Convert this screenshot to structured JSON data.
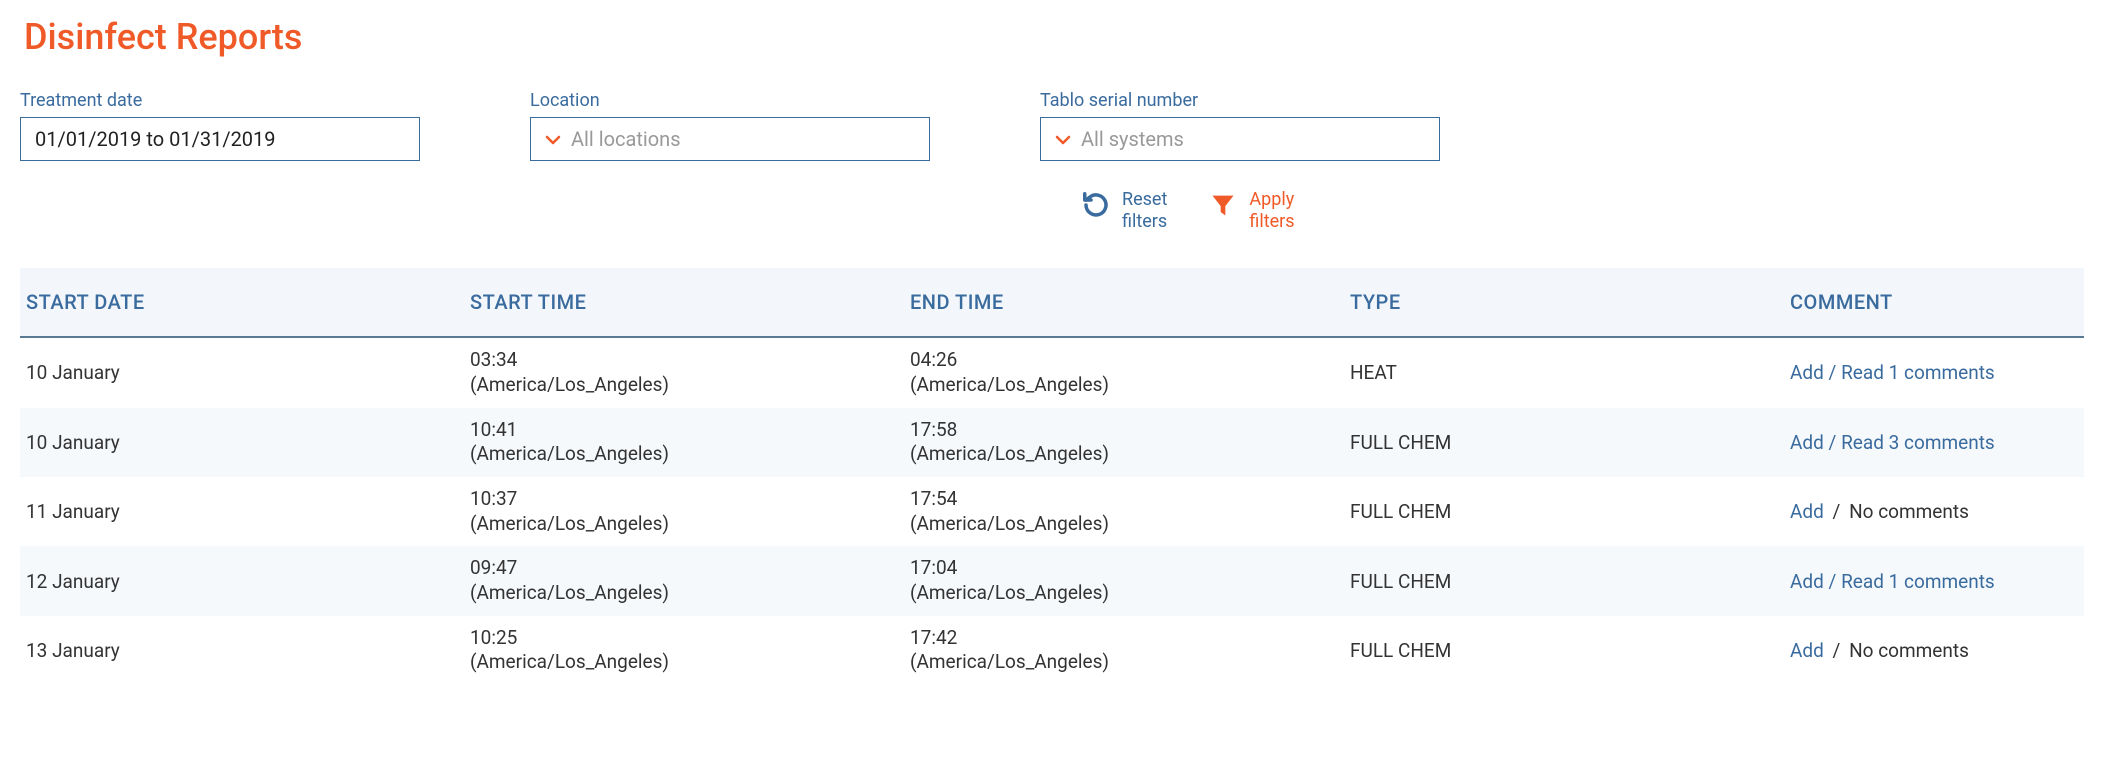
{
  "page": {
    "title": "Disinfect Reports"
  },
  "filters": {
    "treatment_date": {
      "label": "Treatment date",
      "value": "01/01/2019 to 01/31/2019"
    },
    "location": {
      "label": "Location",
      "placeholder": "All locations"
    },
    "serial": {
      "label": "Tablo serial number",
      "placeholder": "All systems"
    }
  },
  "actions": {
    "reset": {
      "line1": "Reset",
      "line2": "filters"
    },
    "apply": {
      "line1": "Apply",
      "line2": "filters"
    }
  },
  "table": {
    "headers": {
      "start_date": "START DATE",
      "start_time": "START TIME",
      "end_time": "END TIME",
      "type": "TYPE",
      "comment": "COMMENT"
    },
    "rows": [
      {
        "start_date": "10 January",
        "start_time": "03:34",
        "start_tz": "(America/Los_Angeles)",
        "end_time": "04:26",
        "end_tz": "(America/Los_Angeles)",
        "type": "HEAT",
        "comment_add": "Add",
        "comment_sep": "/",
        "comment_read": "Read 1 comments",
        "has_read": true
      },
      {
        "start_date": "10 January",
        "start_time": "10:41",
        "start_tz": "(America/Los_Angeles)",
        "end_time": "17:58",
        "end_tz": "(America/Los_Angeles)",
        "type": "FULL CHEM",
        "comment_add": "Add",
        "comment_sep": "/",
        "comment_read": "Read 3 comments",
        "has_read": true
      },
      {
        "start_date": "11 January",
        "start_time": "10:37",
        "start_tz": "(America/Los_Angeles)",
        "end_time": "17:54",
        "end_tz": "(America/Los_Angeles)",
        "type": "FULL CHEM",
        "comment_add": "Add",
        "comment_sep": "/",
        "comment_read": "No comments",
        "has_read": false
      },
      {
        "start_date": "12 January",
        "start_time": "09:47",
        "start_tz": "(America/Los_Angeles)",
        "end_time": "17:04",
        "end_tz": "(America/Los_Angeles)",
        "type": "FULL CHEM",
        "comment_add": "Add",
        "comment_sep": "/",
        "comment_read": "Read 1 comments",
        "has_read": true
      },
      {
        "start_date": "13 January",
        "start_time": "10:25",
        "start_tz": "(America/Los_Angeles)",
        "end_time": "17:42",
        "end_tz": "(America/Los_Angeles)",
        "type": "FULL CHEM",
        "comment_add": "Add",
        "comment_sep": "/",
        "comment_read": "No comments",
        "has_read": false
      }
    ]
  }
}
